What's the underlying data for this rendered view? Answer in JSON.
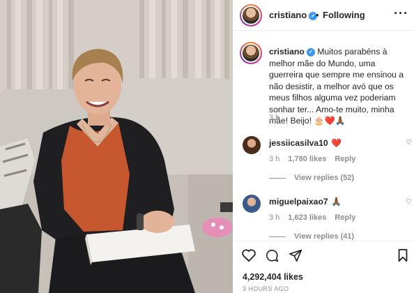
{
  "post": {
    "username": "cristiano",
    "follow_status": "Following",
    "dot": "•",
    "more": "···",
    "caption_text": "Muitos parabéns à melhor mãe do Mundo, uma guerreira que sempre me ensinou a não desistir, a melhor avó que os meus filhos alguma vez poderiam sonhar ter... Amo-te muito, minha mãe! Beijo! 🎂❤️🙏🏾",
    "caption_time": "3 h",
    "likes": "4,292,404 likes",
    "posted_ago": "3 HOURS AGO"
  },
  "comments": [
    {
      "username": "jessiicasilva10",
      "text": "❤️",
      "time": "3 h",
      "likes": "1,780 likes",
      "reply_label": "Reply",
      "view_replies": "View replies (52)"
    },
    {
      "username": "miguelpaixao7",
      "text": "🙏🏾",
      "time": "3 h",
      "likes": "1,623 likes",
      "reply_label": "Reply",
      "view_replies": "View replies (41)"
    }
  ],
  "colors": {
    "verified": "#3897f0",
    "heart": "#ed4956",
    "secondary_text": "#8e8e8e"
  },
  "icons": [
    "verified-icon",
    "more-options-icon",
    "heart-icon",
    "comment-icon",
    "share-icon",
    "bookmark-icon"
  ]
}
